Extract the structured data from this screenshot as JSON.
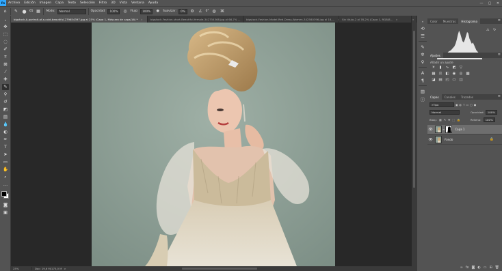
{
  "app": {
    "logo": "Ps"
  },
  "menu": [
    "Archivo",
    "Edición",
    "Imagen",
    "Capa",
    "Texto",
    "Selección",
    "Filtro",
    "3D",
    "Vista",
    "Ventana",
    "Ayuda"
  ],
  "window_controls": [
    "—",
    "▢",
    "✕"
  ],
  "options": {
    "brush_size": "65",
    "mode_label": "Modo:",
    "mode_value": "Normal",
    "opacity_label": "Opacidad:",
    "opacity_value": "100%",
    "flow_label": "Flujo:",
    "flow_value": "100%",
    "smoothing_label": "Suavizar:",
    "smoothing_value": "0%",
    "angle_value": "0°"
  },
  "tabs": [
    {
      "label": "bigstock-A-portrait-of-a-cold-beautiful-279654397.jpg al 25% (Capa 1, Máscara de capa/16) *",
      "close": "×"
    },
    {
      "label": "bigstock-Fashion-short-Beautiful-female-342754368.jpg al 66,7% ...",
      "close": "×"
    },
    {
      "label": "bigstock-Fashion-Model-Red-Dress-Women-342580396.jpg al 18,...",
      "close": "×"
    },
    {
      "label": "Sin título-2 al 76,2% (Capa 1, RGB/8...",
      "close": "×"
    }
  ],
  "tabs_overflow": "»",
  "status": {
    "zoom": "25%",
    "doc": "Doc: 19,6 M/175,0 M",
    "arrow": ">"
  },
  "panels": {
    "top_tabs": [
      "Color",
      "Muestras",
      "Histograma"
    ],
    "top_active": 2,
    "adjust_tabs": [
      "Ajustes"
    ],
    "adjust_hint": "Añadir un ajuste",
    "layers_tabs": [
      "Capas",
      "Canales",
      "Trazados"
    ],
    "filter_label": "Tipo",
    "blend_mode": "Normal",
    "opacity_label": "Opacidad:",
    "opacity_value": "100%",
    "lock_label": "Bloq.:",
    "fill_label": "Relleno:",
    "fill_value": "100%",
    "layers": [
      {
        "name": "Capa 1",
        "selected": true,
        "italic": false
      },
      {
        "name": "Fondo",
        "selected": false,
        "italic": true
      }
    ]
  },
  "histogram": {
    "levels": [
      2,
      2,
      3,
      3,
      4,
      4,
      5,
      6,
      8,
      10,
      12,
      13,
      14,
      16,
      18,
      20,
      24,
      30,
      38,
      44,
      40,
      34,
      28,
      26,
      30,
      36,
      42,
      40,
      32,
      28,
      24,
      26,
      22,
      18,
      14,
      12,
      10,
      8,
      6,
      4
    ]
  }
}
